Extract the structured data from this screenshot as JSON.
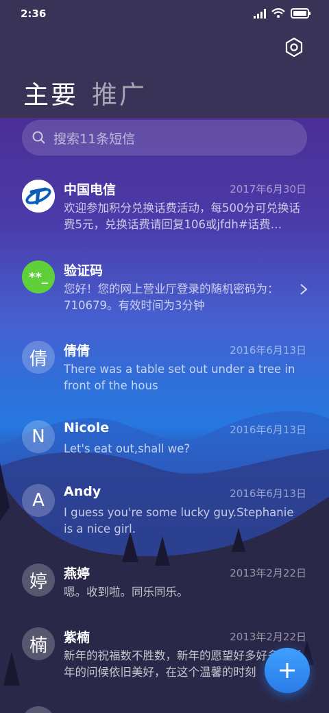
{
  "status_bar": {
    "time": "2:36"
  },
  "tabs": [
    {
      "label": "主要",
      "active": true
    },
    {
      "label": "推广",
      "active": false
    }
  ],
  "search": {
    "placeholder": "搜索11条短信"
  },
  "messages": [
    {
      "sender": "中国电信",
      "date": "2017年6月30日",
      "preview": "欢迎参加积分兑换话费活动，每500分可兑换话费5元，兑换话费请回复106或jfdh#话费…",
      "avatar": "china-telecom-logo"
    },
    {
      "sender": "验证码",
      "date": "",
      "preview": "您好！您的网上营业厅登录的随机密码为：710679。有效时间为3分钟",
      "avatar_text": "**_"
    },
    {
      "sender": "倩倩",
      "date": "2016年6月13日",
      "preview": "There was a table set out under a tree in front of the hous",
      "avatar_text": "倩"
    },
    {
      "sender": "Nicole",
      "date": "2016年6月13日",
      "preview": "Let's eat out,shall we?",
      "avatar_text": "N"
    },
    {
      "sender": "Andy",
      "date": "2016年6月13日",
      "preview": "I guess you're some lucky guy.Stephanie is a nice girl.",
      "avatar_text": "A"
    },
    {
      "sender": "燕婷",
      "date": "2013年2月22日",
      "preview": "嗯。收到啦。同乐同乐。",
      "avatar_text": "婷"
    },
    {
      "sender": "紫楠",
      "date": "2013年2月22日",
      "preview": "新年的祝福数不胜数，新年的愿望好多好多，新年的问候依旧美好，在这个温馨的时刻",
      "avatar_text": "楠"
    }
  ],
  "colors": {
    "verification_avatar": "#5fcf3a",
    "fab": "#2f86f0",
    "telecom_blue": "#0b5eb8"
  },
  "icons": {
    "settings": "settings-icon",
    "fab": "plus-icon",
    "search": "search-icon"
  }
}
